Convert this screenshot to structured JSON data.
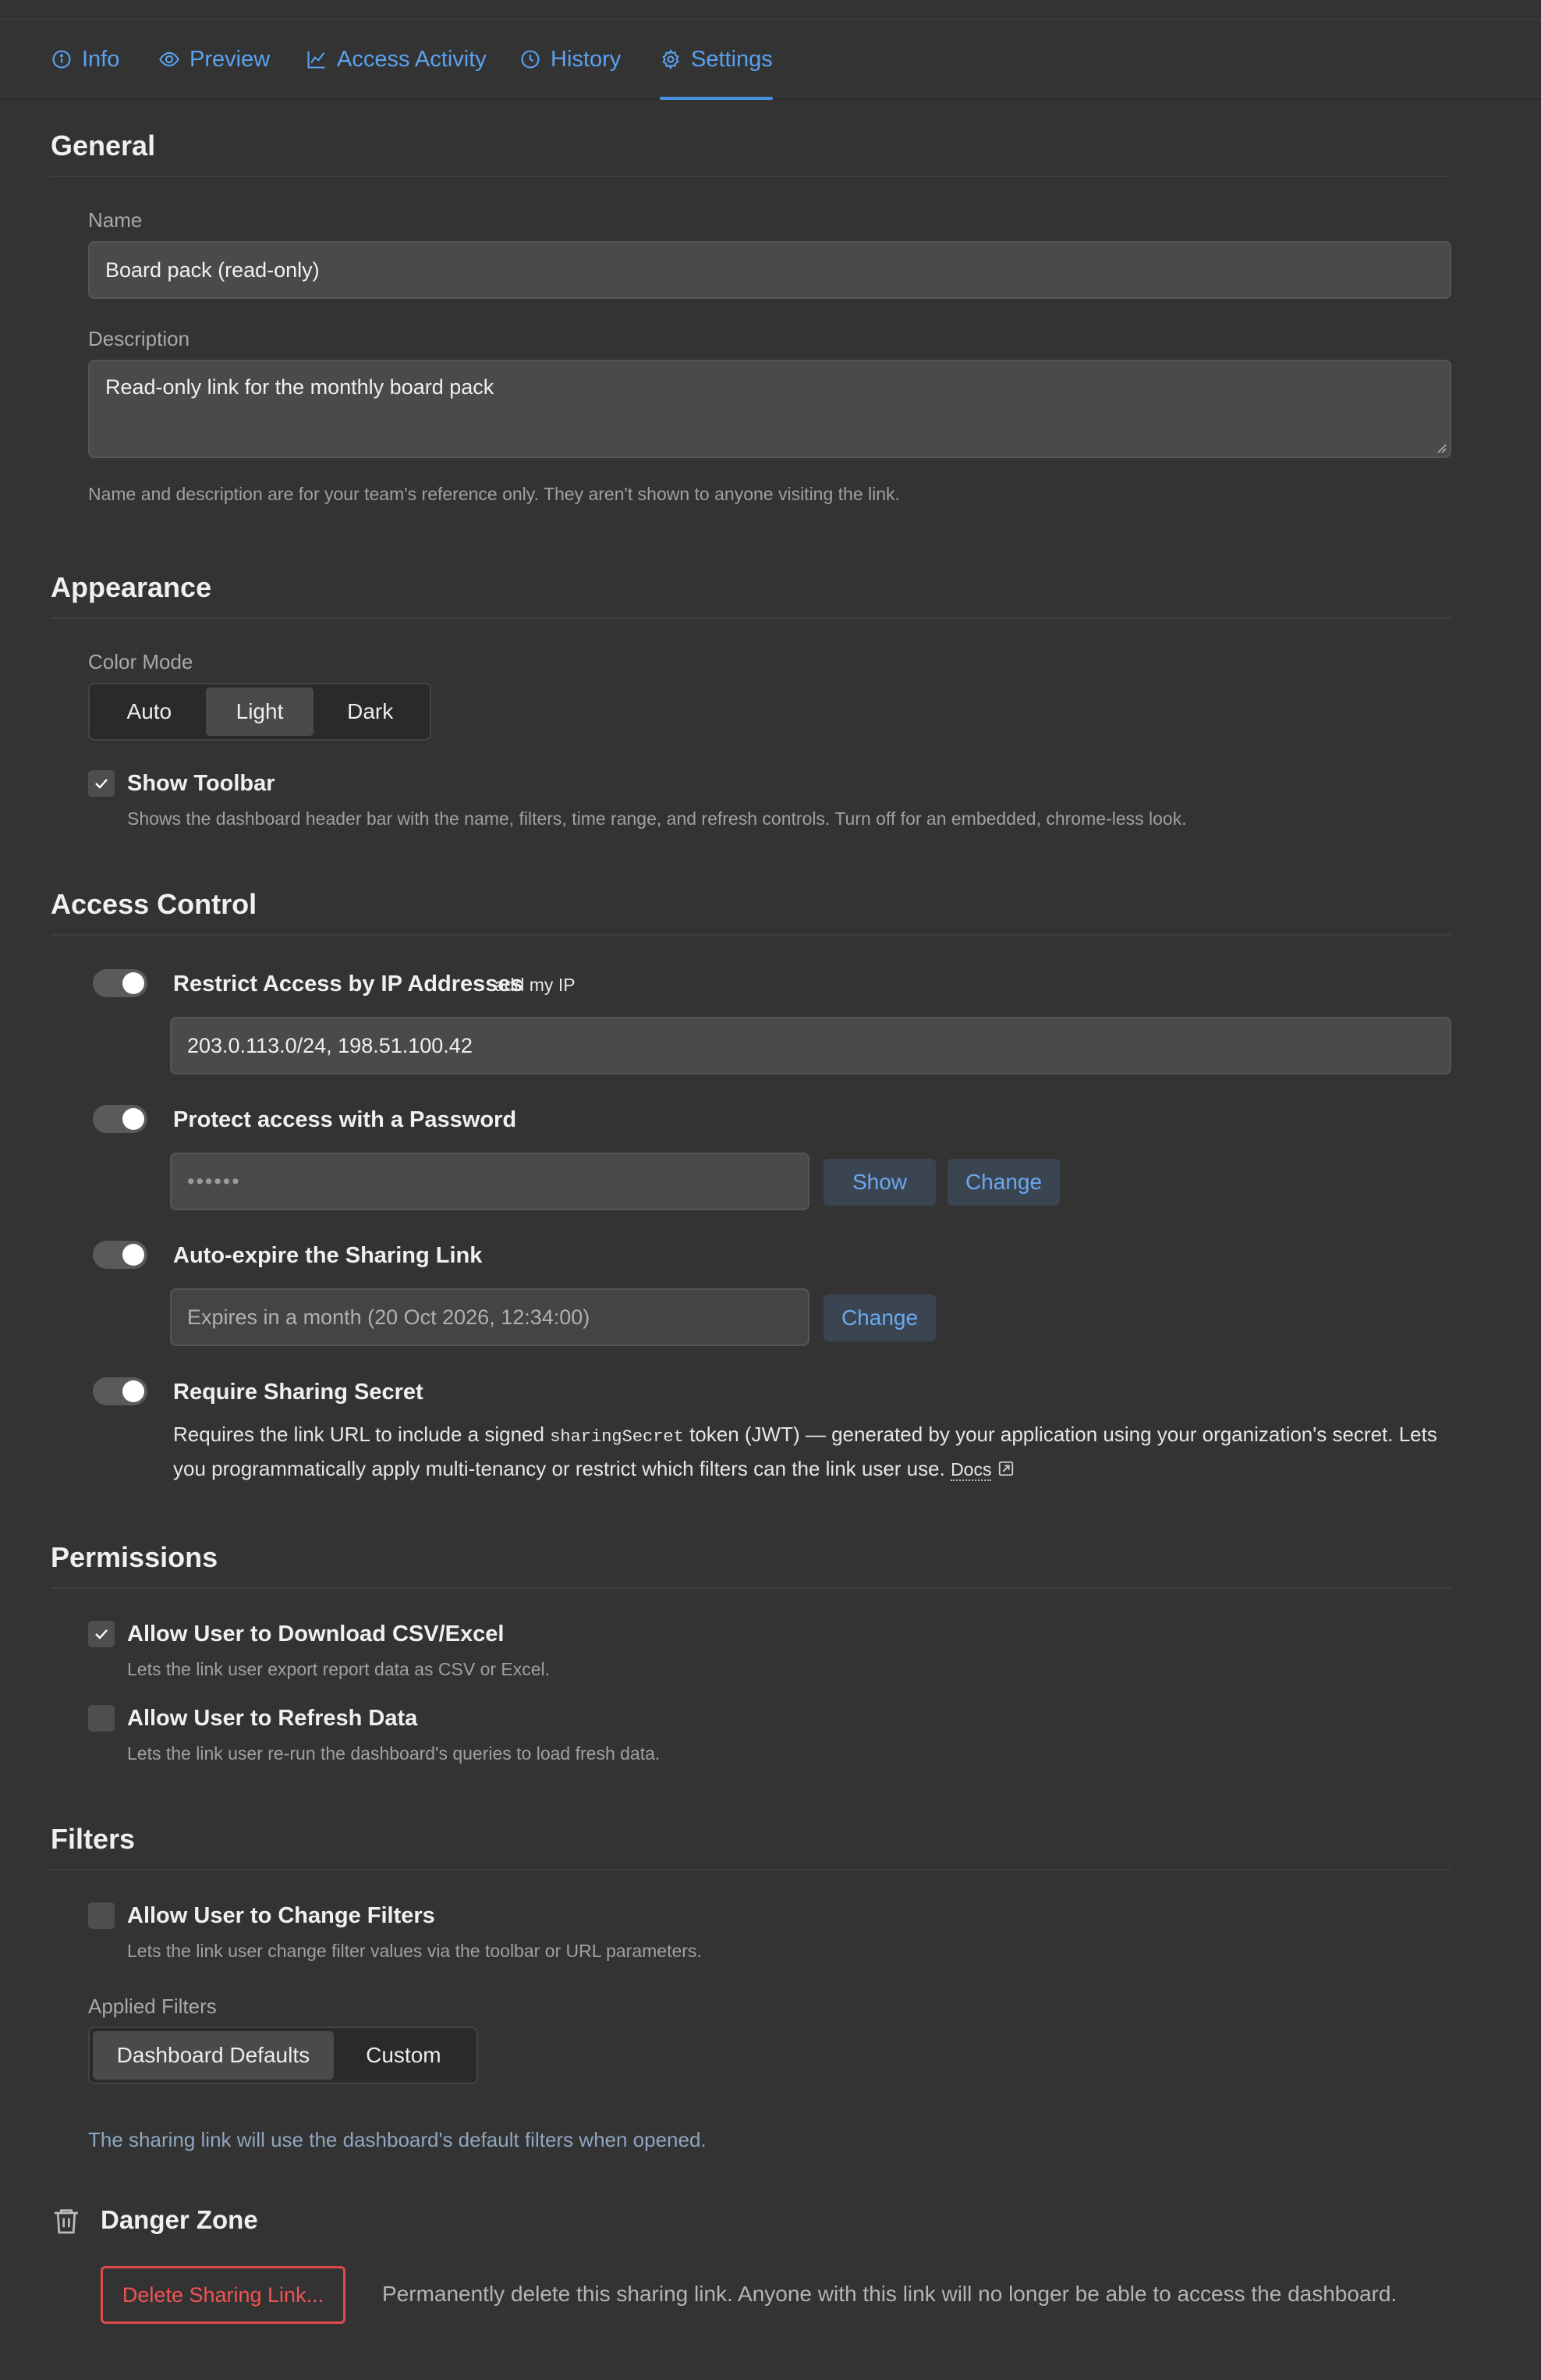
{
  "tabs": [
    {
      "label": "Info",
      "icon": "info-icon"
    },
    {
      "label": "Preview",
      "icon": "eye-icon"
    },
    {
      "label": "Access Activity",
      "icon": "line-chart-icon"
    },
    {
      "label": "History",
      "icon": "clock-icon"
    },
    {
      "label": "Settings",
      "icon": "gear-icon",
      "active": true
    }
  ],
  "general": {
    "title": "General",
    "name_label": "Name",
    "name_value": "Board pack (read-only)",
    "description_label": "Description",
    "description_value": "Read-only link for the monthly board pack",
    "hint": "Name and description are for your team's reference only. They aren't shown to anyone visiting the link."
  },
  "appearance": {
    "title": "Appearance",
    "color_mode_label": "Color Mode",
    "color_modes": [
      "Auto",
      "Light",
      "Dark"
    ],
    "selected_color_mode": "Light",
    "show_toolbar_label": "Show Toolbar",
    "show_toolbar_checked": true,
    "show_toolbar_hint": "Shows the dashboard header bar with the name, filters, time range, and refresh controls. Turn off for an embedded, chrome-less look."
  },
  "access_control": {
    "title": "Access Control",
    "ip": {
      "label": "Restrict Access by IP Addresses",
      "link": "add my IP",
      "value": "203.0.113.0/24, 198.51.100.42",
      "enabled": true
    },
    "password": {
      "label": "Protect access with a Password",
      "value": "••••••",
      "show_label": "Show",
      "change_label": "Change",
      "enabled": true
    },
    "expire": {
      "label": "Auto-expire the Sharing Link",
      "value": "Expires in a month (20 Oct 2026, 12:34:00)",
      "change_label": "Change",
      "enabled": true
    },
    "secret": {
      "label": "Require Sharing Secret",
      "enabled": true,
      "text_before": "Requires the link URL to include a signed ",
      "code": "sharingSecret",
      "text_after": " token (JWT) — generated by your application using your organization's secret. Lets you programmatically apply multi-tenancy or restrict which filters can the link user use. ",
      "docs_label": "Docs"
    }
  },
  "permissions": {
    "title": "Permissions",
    "download": {
      "label": "Allow User to Download CSV/Excel",
      "hint": "Lets the link user export report data as CSV or Excel.",
      "checked": true
    },
    "refresh": {
      "label": "Allow User to Refresh Data",
      "hint": "Lets the link user re-run the dashboard's queries to load fresh data.",
      "checked": false
    }
  },
  "filters": {
    "title": "Filters",
    "change": {
      "label": "Allow User to Change Filters",
      "hint": "Lets the link user change filter values via the toolbar or URL parameters.",
      "checked": false
    },
    "applied_label": "Applied Filters",
    "options": [
      "Dashboard Defaults",
      "Custom"
    ],
    "selected": "Dashboard Defaults",
    "note": "The sharing link will use the dashboard's default filters when opened."
  },
  "danger": {
    "title": "Danger Zone",
    "delete_label": "Delete Sharing Link...",
    "delete_hint": "Permanently delete this sharing link. Anyone with this link will no longer be able to access the dashboard."
  }
}
